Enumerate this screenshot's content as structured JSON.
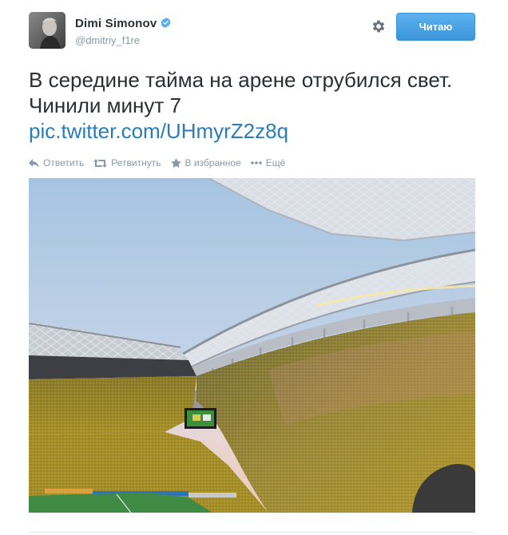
{
  "user": {
    "full_name": "Dimi Simonov",
    "username": "@dmitriy_f1re",
    "verified": true,
    "avatar_icon": "avatar-photo"
  },
  "header": {
    "settings_icon": "gear-icon",
    "follow_label": "Читаю"
  },
  "tweet": {
    "text_line1": "В середине тайма на арене отрубился свет.",
    "text_line2": "Чинили минут 7",
    "link": "pic.twitter.com/UHmyrZ2z8q"
  },
  "actions": {
    "reply_label": "Ответить",
    "retweet_label": "Ретвитнуть",
    "favorite_label": "В избранное",
    "more_label": "Ещё"
  },
  "media": {
    "description_icon": "stadium-photo"
  },
  "colors": {
    "link": "#2b7bb9",
    "meta_gray": "#8899a6",
    "follow_button": "#3b94d9",
    "verified_badge": "#55acee"
  }
}
